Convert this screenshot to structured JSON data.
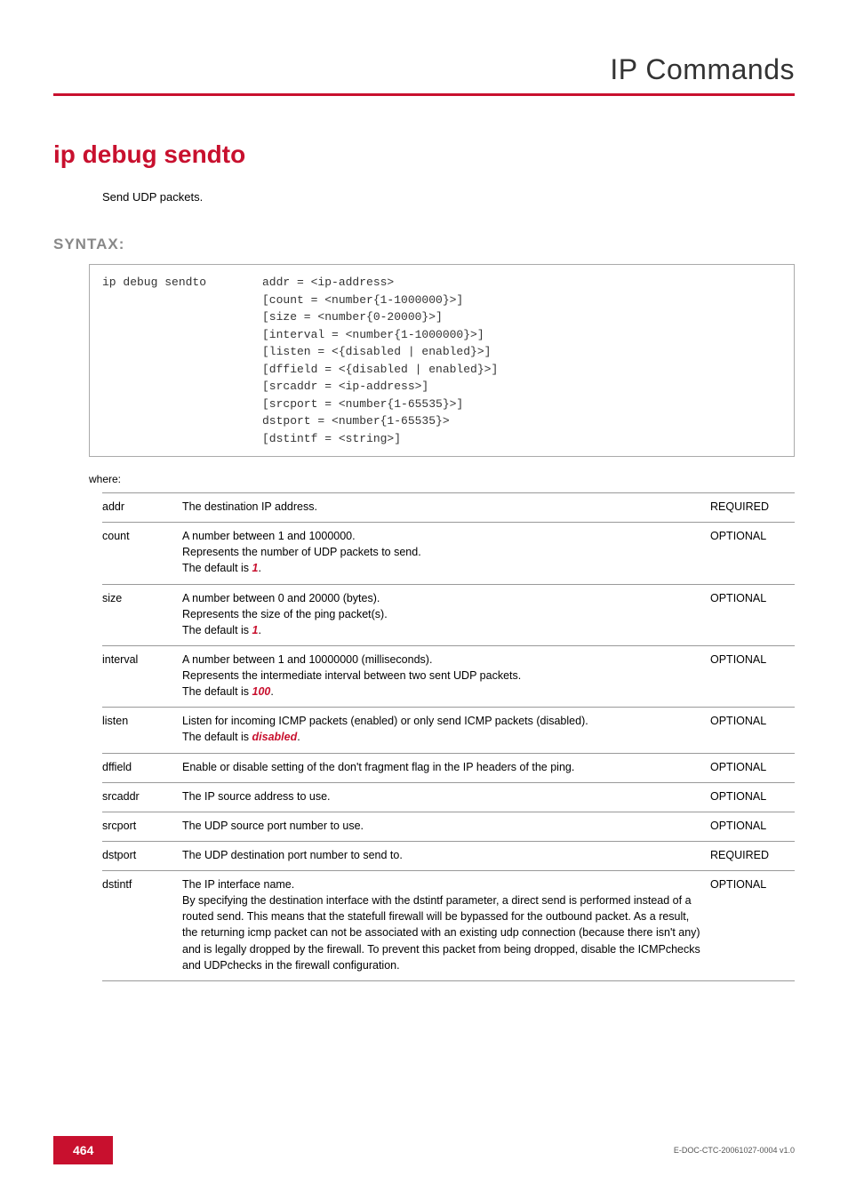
{
  "header": {
    "section": "IP Commands"
  },
  "command": {
    "title": "ip debug sendto",
    "description": "Send UDP packets."
  },
  "syntax": {
    "heading": "SYNTAX:",
    "cmd": "ip debug sendto",
    "args": "addr = <ip-address>\n[count = <number{1-1000000}>]\n[size = <number{0-20000}>]\n[interval = <number{1-1000000}>]\n[listen = <{disabled | enabled}>]\n[dffield = <{disabled | enabled}>]\n[srcaddr = <ip-address>]\n[srcport = <number{1-65535}>]\ndstport = <number{1-65535}>\n[dstintf = <string>]"
  },
  "where_label": "where:",
  "params": [
    {
      "name": "addr",
      "req": "REQUIRED",
      "desc_pre": "The destination IP address.",
      "default": "",
      "desc_post": ""
    },
    {
      "name": "count",
      "req": "OPTIONAL",
      "desc_pre": "A number between 1 and 1000000.\nRepresents the number of UDP packets to send.\nThe default is ",
      "default": "1",
      "desc_post": "."
    },
    {
      "name": "size",
      "req": "OPTIONAL",
      "desc_pre": "A number between 0 and 20000 (bytes).\nRepresents the size of the ping packet(s).\nThe default is ",
      "default": "1",
      "desc_post": "."
    },
    {
      "name": "interval",
      "req": "OPTIONAL",
      "desc_pre": "A number between 1 and 10000000 (milliseconds).\nRepresents the intermediate interval between two sent UDP packets.\nThe default is ",
      "default": "100",
      "desc_post": "."
    },
    {
      "name": "listen",
      "req": "OPTIONAL",
      "desc_pre": "Listen for incoming ICMP packets (enabled) or only send ICMP packets (disabled).\nThe default is ",
      "default": "disabled",
      "desc_post": "."
    },
    {
      "name": "dffield",
      "req": "OPTIONAL",
      "desc_pre": "Enable or disable setting of the don't fragment flag in the IP headers of the ping.",
      "default": "",
      "desc_post": ""
    },
    {
      "name": "srcaddr",
      "req": "OPTIONAL",
      "desc_pre": "The IP source address to use.",
      "default": "",
      "desc_post": ""
    },
    {
      "name": "srcport",
      "req": "OPTIONAL",
      "desc_pre": "The UDP source port number to use.",
      "default": "",
      "desc_post": ""
    },
    {
      "name": "dstport",
      "req": "REQUIRED",
      "desc_pre": "The UDP destination port number to send to.",
      "default": "",
      "desc_post": ""
    },
    {
      "name": "dstintf",
      "req": "OPTIONAL",
      "desc_pre": "The IP interface name.\nBy specifying the destination interface with the dstintf parameter, a direct send is performed instead of a routed send. This means that the statefull firewall will be bypassed for the outbound packet. As a result, the returning icmp packet can not be associated with an existing udp connection (because there isn't any) and is legally dropped by the firewall. To prevent this packet from being dropped, disable the ICMPchecks and UDPchecks in the firewall configuration.",
      "default": "",
      "desc_post": ""
    }
  ],
  "footer": {
    "page": "464",
    "docid": "E-DOC-CTC-20061027-0004 v1.0"
  }
}
